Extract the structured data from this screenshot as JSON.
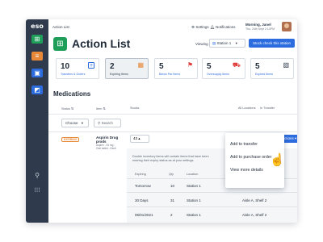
{
  "app": {
    "logo": "eso"
  },
  "header": {
    "breadcrumb": "Action List",
    "settings": "Settings",
    "notifications": "Notifications",
    "greeting": "Morning, Janel",
    "date": "Thu, 24th Sept 2:14PM"
  },
  "page": {
    "title": "Action List",
    "viewing_label": "Viewing",
    "station_value": "Station 1",
    "stock_button": "Stock check this station"
  },
  "summary_cards": [
    {
      "count": "10",
      "label": "Transfers & Orders",
      "icon": "plus-square-icon",
      "color": "#2d6cdf"
    },
    {
      "count": "2",
      "label": "Expiring Items",
      "icon": "calendar-icon",
      "color": "#e8893a"
    },
    {
      "count": "5",
      "label": "Below Par Items",
      "icon": "flag-icon",
      "color": "#e23b3b"
    },
    {
      "count": "5",
      "label": "Oversupply Items",
      "icon": "truck-icon",
      "color": "#e23b3b"
    },
    {
      "count": "5",
      "label": "Expired Items",
      "icon": "expired-calendar-icon",
      "color": "#2f3b4c"
    }
  ],
  "section": {
    "title": "Medications"
  },
  "table": {
    "headers": [
      "Status",
      "Item",
      "Stocks",
      "All Locations",
      "In Transfer"
    ],
    "status_filter": "Choose",
    "search_placeholder": "Search"
  },
  "row": {
    "status": "EXPIRING",
    "name_line1": "Aspirin Drug",
    "name_line2": "prods",
    "sub_line1": "Aspirin - 81 mg -",
    "sub_line2": "Oral tablet - Each",
    "stock": "43",
    "all_locations": "150",
    "in_transfer": "0",
    "actions_label": "Actions"
  },
  "subtable": {
    "note_line1": "Double inventory items will contain items that have been",
    "note_line2": "nearing their expiry status as at your settings.",
    "headers": [
      "Expiring",
      "Qty",
      "Location"
    ],
    "rows": [
      {
        "expiring": "Tomorrow",
        "qty": "10",
        "location": "Station 1",
        "shelf": "Aisle A, Shelf 2"
      },
      {
        "expiring": "30 Days",
        "qty": "31",
        "location": "Station 1",
        "shelf": "Aisle A, Shelf 2"
      },
      {
        "expiring": "05/01/2021",
        "qty": "2",
        "location": "Station 1",
        "shelf": "Aisle A, Shelf 2"
      }
    ]
  },
  "menu": {
    "items": [
      "Add to transfer",
      "Add to purchase order",
      "View more details"
    ]
  },
  "colors": {
    "accent": "#2d6cdf",
    "brand_green": "#1f9e5a",
    "rail": "#2f3b4c",
    "warning": "#e8893a"
  }
}
